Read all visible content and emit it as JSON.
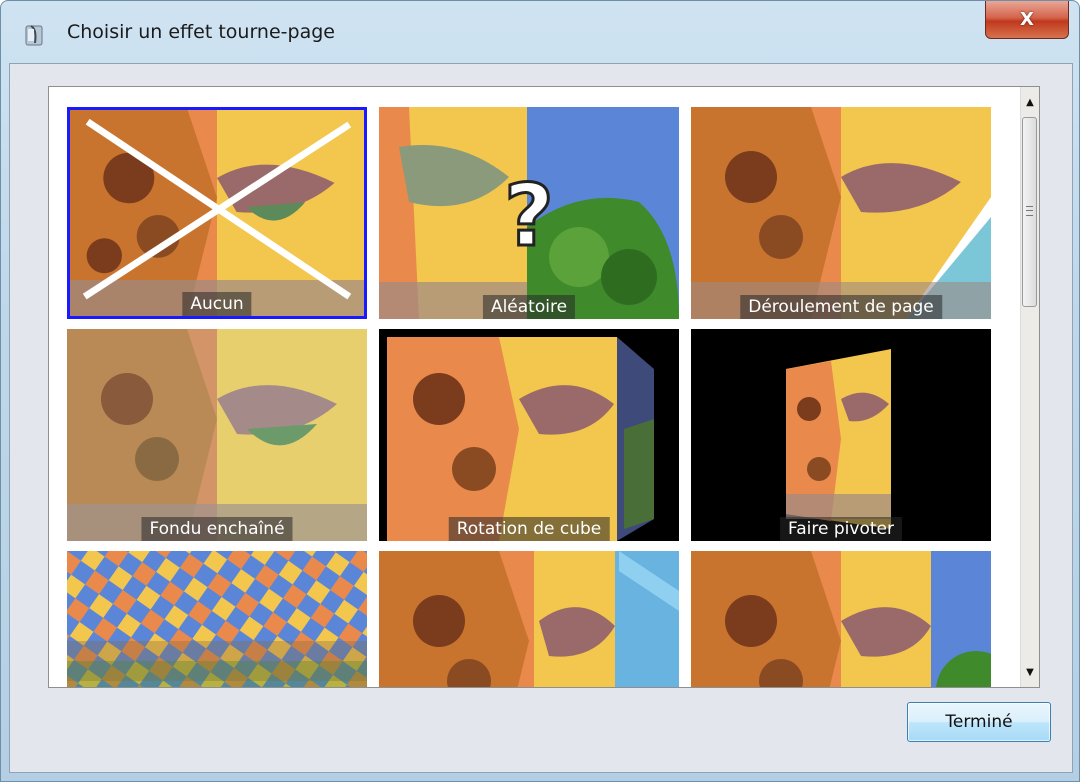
{
  "window": {
    "title": "Choisir un effet tourne-page",
    "close_symbol": "X"
  },
  "gallery": {
    "effects": [
      {
        "label": "Aucun",
        "selected": true
      },
      {
        "label": "Aléatoire",
        "selected": false
      },
      {
        "label": "Déroulement de page",
        "selected": false
      },
      {
        "label": "Fondu enchaîné",
        "selected": false
      },
      {
        "label": "Rotation de cube",
        "selected": false
      },
      {
        "label": "Faire pivoter",
        "selected": false
      },
      {
        "label": "",
        "selected": false
      },
      {
        "label": "",
        "selected": false
      },
      {
        "label": "",
        "selected": false
      }
    ],
    "random_symbol": "?"
  },
  "buttons": {
    "done_label": "Terminé"
  },
  "colors": {
    "selection_border": "#1a1aff",
    "giraffe_orange": "#e98a4c",
    "sky_yellow": "#f6d25a",
    "blue_panel": "#5b86d8",
    "green_foliage": "#3f8a2a"
  }
}
